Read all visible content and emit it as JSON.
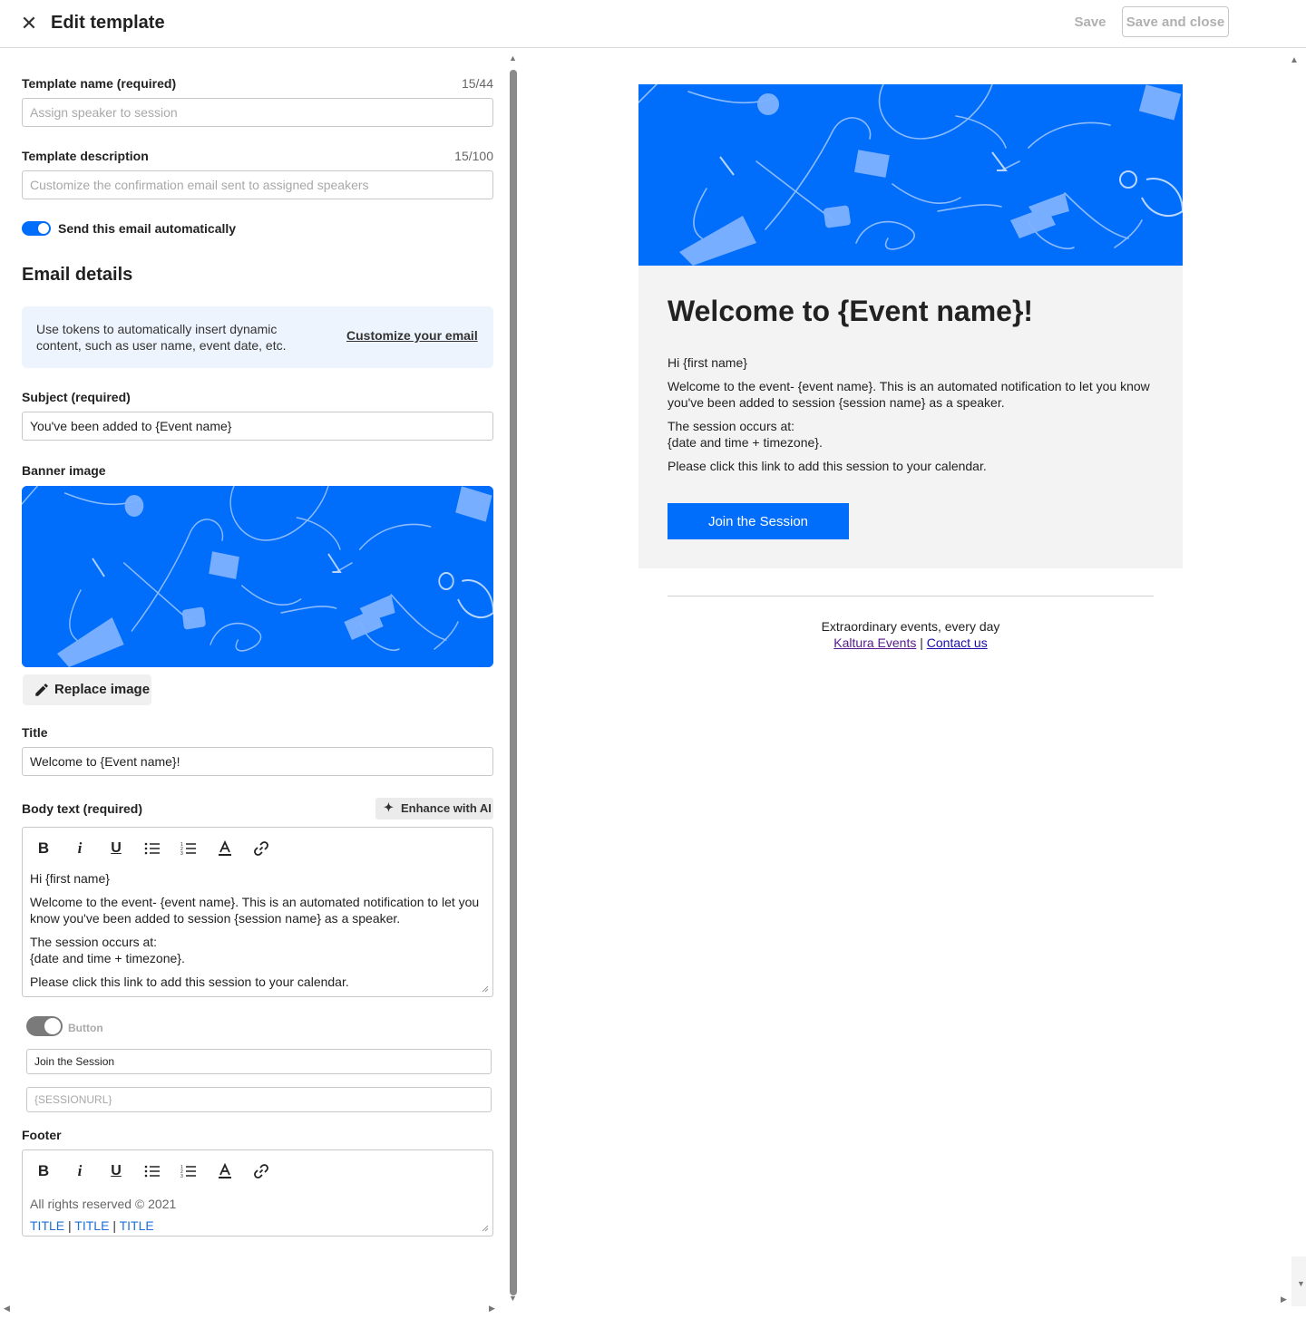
{
  "header": {
    "title": "Edit template",
    "save_label": "Save",
    "save_close_label": "Save and close"
  },
  "form": {
    "template_name": {
      "label": "Template name (required)",
      "counter": "15/44",
      "placeholder": "Assign speaker to session"
    },
    "template_description": {
      "label": "Template description",
      "counter": "15/100",
      "placeholder": "Customize the confirmation email sent to assigned speakers"
    },
    "auto_send": {
      "label": "Send this email automatically",
      "enabled": true
    },
    "email_details_title": "Email details",
    "info": {
      "text": "Use tokens to automatically insert dynamic content, such as user name, event date, etc.",
      "link": "Customize your email"
    },
    "subject": {
      "label": "Subject (required)",
      "value": "You've been added to {Event name}"
    },
    "banner": {
      "label": "Banner image",
      "replace_label": "Replace image"
    },
    "title": {
      "label": "Title",
      "value": "Welcome to {Event name}!"
    },
    "body": {
      "label": "Body text (required)",
      "ai_label": "Enhance with AI",
      "p1": "Hi {first name}",
      "p2": "Welcome to the event- {event name}. This is an automated notification to let you know you've been added to session {session name} as a speaker.",
      "p3a": "The session occurs at:",
      "p3b": "{date and time + timezone}.",
      "p4": "Please click this link to add this session to your calendar."
    },
    "button": {
      "label": "Button",
      "enabled": false,
      "text_value": "Join the Session",
      "url_placeholder": "{SESSIONURL}"
    },
    "footer": {
      "label": "Footer",
      "line1": "All rights reserved © 2021",
      "links": [
        "TITLE",
        "TITLE",
        "TITLE"
      ],
      "sep": "|"
    }
  },
  "preview": {
    "title": "Welcome to {Event name}!",
    "p1": "Hi {first name}",
    "p2": "Welcome to the event- {event name}. This is an automated notification to let you know you've been added to session {session name} as a speaker.",
    "p3a": "The session occurs at:",
    "p3b": "{date and time + timezone}.",
    "p4": "Please click this link to add this session to your calendar.",
    "button_label": "Join the Session",
    "footer_tagline": "Extraordinary events, every day",
    "footer_link1": "Kaltura Events",
    "footer_sep": "|",
    "footer_link2": "Contact us"
  },
  "colors": {
    "accent": "#006efa",
    "info_bg": "#eef4fd",
    "card_bg": "#f3f3f3"
  },
  "icons": [
    "close-icon",
    "pencil-icon",
    "sparkle-icon",
    "bold-icon",
    "italic-icon",
    "underline-icon",
    "bullet-list-icon",
    "numbered-list-icon",
    "text-color-icon",
    "link-icon"
  ]
}
